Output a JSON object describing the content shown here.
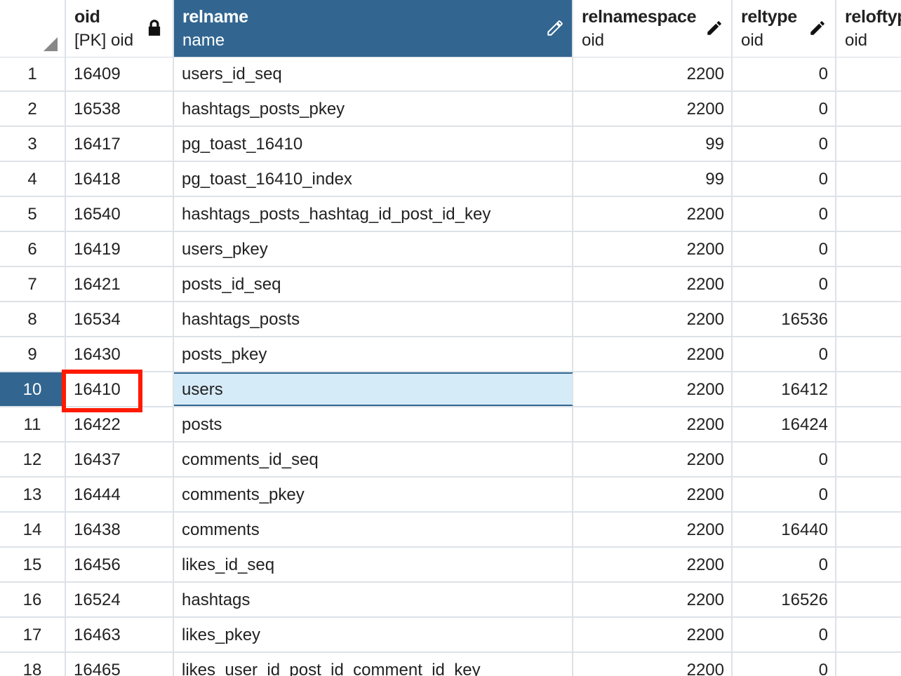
{
  "columns": [
    {
      "name": "oid",
      "type": "[PK] oid",
      "icon": "lock-icon"
    },
    {
      "name": "relname",
      "type": "name",
      "icon": "pencil-icon"
    },
    {
      "name": "relnamespace",
      "type": "oid",
      "icon": "pencil-icon"
    },
    {
      "name": "reltype",
      "type": "oid",
      "icon": "pencil-icon"
    },
    {
      "name": "reloftyp",
      "type": "oid",
      "icon": ""
    }
  ],
  "rows": [
    {
      "num": "1",
      "oid": "16409",
      "relname": "users_id_seq",
      "relnamespace": "2200",
      "reltype": "0"
    },
    {
      "num": "2",
      "oid": "16538",
      "relname": "hashtags_posts_pkey",
      "relnamespace": "2200",
      "reltype": "0"
    },
    {
      "num": "3",
      "oid": "16417",
      "relname": "pg_toast_16410",
      "relnamespace": "99",
      "reltype": "0"
    },
    {
      "num": "4",
      "oid": "16418",
      "relname": "pg_toast_16410_index",
      "relnamespace": "99",
      "reltype": "0"
    },
    {
      "num": "5",
      "oid": "16540",
      "relname": "hashtags_posts_hashtag_id_post_id_key",
      "relnamespace": "2200",
      "reltype": "0"
    },
    {
      "num": "6",
      "oid": "16419",
      "relname": "users_pkey",
      "relnamespace": "2200",
      "reltype": "0"
    },
    {
      "num": "7",
      "oid": "16421",
      "relname": "posts_id_seq",
      "relnamespace": "2200",
      "reltype": "0"
    },
    {
      "num": "8",
      "oid": "16534",
      "relname": "hashtags_posts",
      "relnamespace": "2200",
      "reltype": "16536"
    },
    {
      "num": "9",
      "oid": "16430",
      "relname": "posts_pkey",
      "relnamespace": "2200",
      "reltype": "0"
    },
    {
      "num": "10",
      "oid": "16410",
      "relname": "users",
      "relnamespace": "2200",
      "reltype": "16412"
    },
    {
      "num": "11",
      "oid": "16422",
      "relname": "posts",
      "relnamespace": "2200",
      "reltype": "16424"
    },
    {
      "num": "12",
      "oid": "16437",
      "relname": "comments_id_seq",
      "relnamespace": "2200",
      "reltype": "0"
    },
    {
      "num": "13",
      "oid": "16444",
      "relname": "comments_pkey",
      "relnamespace": "2200",
      "reltype": "0"
    },
    {
      "num": "14",
      "oid": "16438",
      "relname": "comments",
      "relnamespace": "2200",
      "reltype": "16440"
    },
    {
      "num": "15",
      "oid": "16456",
      "relname": "likes_id_seq",
      "relnamespace": "2200",
      "reltype": "0"
    },
    {
      "num": "16",
      "oid": "16524",
      "relname": "hashtags",
      "relnamespace": "2200",
      "reltype": "16526"
    },
    {
      "num": "17",
      "oid": "16463",
      "relname": "likes_pkey",
      "relnamespace": "2200",
      "reltype": "0"
    },
    {
      "num": "18",
      "oid": "16465",
      "relname": "likes_user_id_post_id_comment_id_key",
      "relnamespace": "2200",
      "reltype": "0"
    }
  ],
  "selected_row": "10",
  "selected_column": "relname",
  "highlighted_cell": "16410",
  "colors": {
    "header_selected": "#326690",
    "row_selected_cell": "#d6ebf8",
    "highlight_border": "#ff1a00",
    "grid_line": "#dde2e8"
  }
}
